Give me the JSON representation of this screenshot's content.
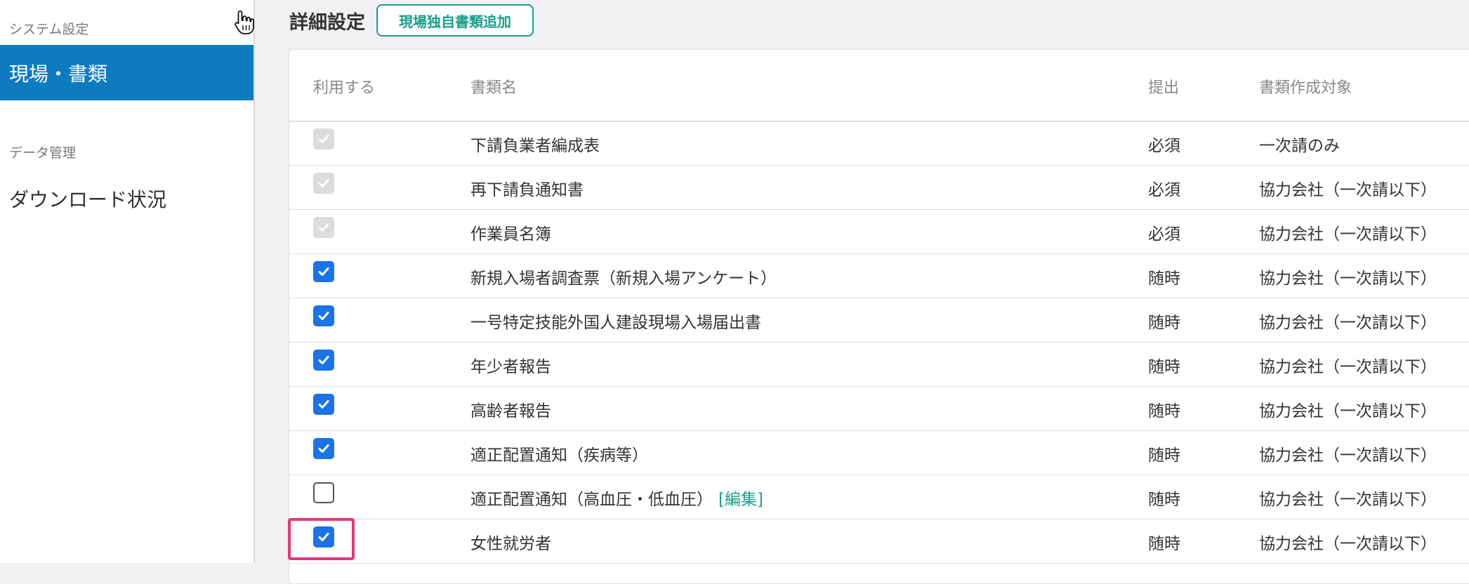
{
  "sidebar": {
    "section1_heading": "システム設定",
    "active_item": "現場・書類",
    "section2_heading": "データ管理",
    "item_download": "ダウンロード状況"
  },
  "header": {
    "title": "詳細設定",
    "add_button": "現場独自書類追加"
  },
  "table": {
    "columns": {
      "use": "利用する",
      "name": "書類名",
      "submission": "提出",
      "target": "書類作成対象"
    },
    "edit_label": "[編集]",
    "rows": [
      {
        "state": "disabled",
        "name": "下請負業者編成表",
        "submission": "必須",
        "target": "一次請のみ"
      },
      {
        "state": "disabled",
        "name": "再下請負通知書",
        "submission": "必須",
        "target": "協力会社（一次請以下）"
      },
      {
        "state": "disabled",
        "name": "作業員名簿",
        "submission": "必須",
        "target": "協力会社（一次請以下）"
      },
      {
        "state": "checked",
        "name": "新規入場者調査票（新規入場アンケート）",
        "submission": "随時",
        "target": "協力会社（一次請以下）"
      },
      {
        "state": "checked",
        "name": "一号特定技能外国人建設現場入場届出書",
        "submission": "随時",
        "target": "協力会社（一次請以下）"
      },
      {
        "state": "checked",
        "name": "年少者報告",
        "submission": "随時",
        "target": "協力会社（一次請以下）"
      },
      {
        "state": "checked",
        "name": "高齢者報告",
        "submission": "随時",
        "target": "協力会社（一次請以下）"
      },
      {
        "state": "checked",
        "name": "適正配置通知（疾病等）",
        "submission": "随時",
        "target": "協力会社（一次請以下）"
      },
      {
        "state": "unchecked",
        "name": "適正配置通知（高血圧・低血圧）",
        "submission": "随時",
        "target": "協力会社（一次請以下）",
        "editable": true
      },
      {
        "state": "checked",
        "name": "女性就労者",
        "submission": "随時",
        "target": "協力会社（一次請以下）"
      }
    ]
  },
  "colors": {
    "sidebar_active": "#0d7bbf",
    "accent": "#17a08c",
    "checkbox": "#1a73e8",
    "highlight": "#e8357a"
  },
  "icons": {
    "cursor": "hand-pointer-icon",
    "check": "checkmark-icon"
  }
}
